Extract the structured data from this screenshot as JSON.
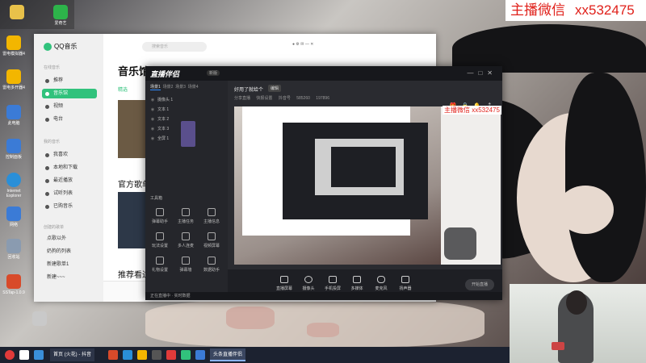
{
  "streamer_label": {
    "text1": "主播微信",
    "text2": "xx532475"
  },
  "desktop_icons": [
    {
      "label": "爱奇艺",
      "color": "#2db34a"
    },
    {
      "label": "雷电模拟器4",
      "color": "#f3b600"
    },
    {
      "label": "雷电多开器4",
      "color": "#f3b600"
    },
    {
      "label": "此电脑",
      "color": "#3b7bd6"
    },
    {
      "label": "控制面板",
      "color": "#3b7bd6"
    },
    {
      "label": "Internet Explorer",
      "color": "#2a8fd8"
    },
    {
      "label": "网络",
      "color": "#3b7bd6"
    },
    {
      "label": "回收站",
      "color": "#8a9bb0"
    },
    {
      "label": "SSTap-1.0.9",
      "color": "#d84a2a"
    }
  ],
  "qq_music": {
    "app_name": "QQ音乐",
    "search_placeholder": "搜索音乐",
    "section_online": "在线音乐",
    "nav": [
      {
        "label": "推荐",
        "active": false
      },
      {
        "label": "音乐馆",
        "active": true
      },
      {
        "label": "视频",
        "active": false
      },
      {
        "label": "电台",
        "active": false
      }
    ],
    "section_mine": "我的音乐",
    "mine": [
      {
        "label": "我喜欢"
      },
      {
        "label": "本地和下载"
      },
      {
        "label": "最近播放"
      },
      {
        "label": "试听列表"
      },
      {
        "label": "已购音乐"
      }
    ],
    "section_created": "创建的歌单",
    "created": [
      {
        "label": "点歌以外"
      },
      {
        "label": "奶狗的列表"
      },
      {
        "label": "新建歌单1"
      },
      {
        "label": "新建~~~"
      }
    ],
    "page_title": "音乐馆",
    "tab_selected": "精选",
    "heading_official": "官方歌单",
    "heading_recommended": "推荐看过"
  },
  "live_partner": {
    "brand": "直播伴侣",
    "version_badge": "新版",
    "scene_tabs": [
      "场景1",
      "场景2",
      "场景3",
      "场景4"
    ],
    "layers": [
      {
        "label": "摄像头 1"
      },
      {
        "label": "文本 1"
      },
      {
        "label": "文本 2"
      },
      {
        "label": "文本 3"
      },
      {
        "label": "全屏 1"
      }
    ],
    "tools_header": "工具箱",
    "tools": [
      {
        "label": "弹幕助手"
      },
      {
        "label": "主播任务"
      },
      {
        "label": "主播信息"
      },
      {
        "label": "玩法设置"
      },
      {
        "label": "多人连麦"
      },
      {
        "label": "视频屏幕"
      },
      {
        "label": "礼物设置"
      },
      {
        "label": "弹幕墙"
      },
      {
        "label": "数据助手"
      }
    ],
    "live_title": "好用了就给个",
    "edit_label": "编辑",
    "meta": [
      "分享直播",
      "快报设置",
      "抖音号",
      "585260",
      "197896"
    ],
    "controls": [
      {
        "label": "直播屏幕"
      },
      {
        "label": "摄像头"
      },
      {
        "label": "手机投屏"
      },
      {
        "label": "多媒体"
      },
      {
        "label": "麦克风"
      },
      {
        "label": "扬声器"
      }
    ],
    "start_label": "开始直播",
    "status": "正在直播中 · 实时数据",
    "overlay_label": "主播微信 xx532475"
  },
  "taskbar": {
    "apps": [
      {
        "label": "首页 (火花) - 抖音",
        "active": false
      },
      {
        "label": "头条直播伴侣",
        "active": true
      }
    ]
  }
}
